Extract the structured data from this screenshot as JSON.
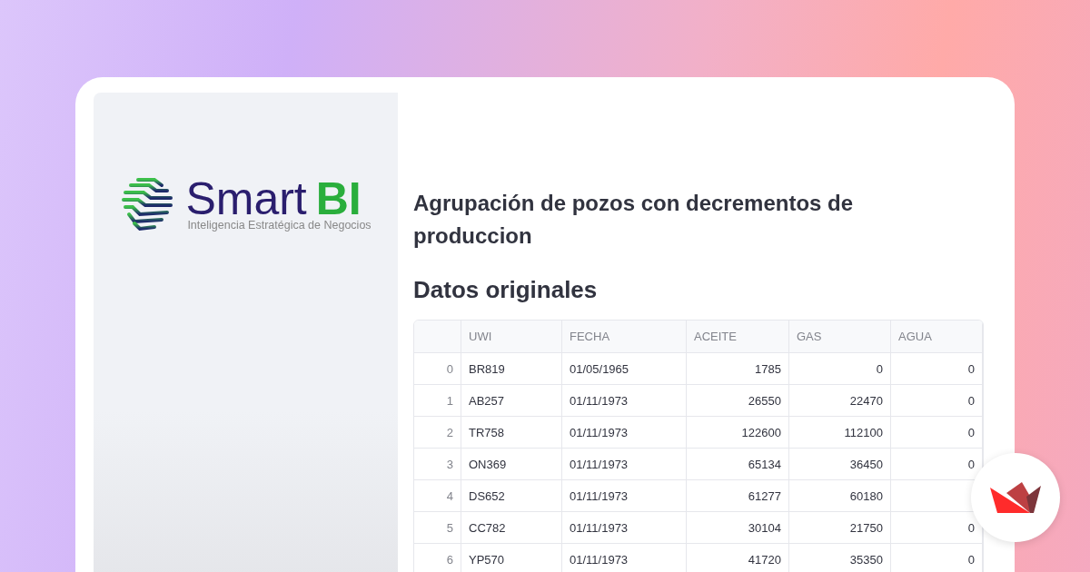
{
  "logo": {
    "name": "Smart",
    "accent": "BI",
    "tagline": "Inteligencia Estratégica de Negocios"
  },
  "title": "Agrupación de pozos con decrementos de produccion",
  "subheading": "Datos originales",
  "table": {
    "columns": [
      "UWI",
      "FECHA",
      "ACEITE",
      "GAS",
      "AGUA"
    ],
    "rows": [
      {
        "index": "0",
        "cells": [
          "BR819",
          "01/05/1965",
          "1785",
          "0",
          "0"
        ]
      },
      {
        "index": "1",
        "cells": [
          "AB257",
          "01/11/1973",
          "26550",
          "22470",
          "0"
        ]
      },
      {
        "index": "2",
        "cells": [
          "TR758",
          "01/11/1973",
          "122600",
          "112100",
          "0"
        ]
      },
      {
        "index": "3",
        "cells": [
          "ON369",
          "01/11/1973",
          "65134",
          "36450",
          "0"
        ]
      },
      {
        "index": "4",
        "cells": [
          "DS652",
          "01/11/1973",
          "61277",
          "60180"
        ]
      },
      {
        "index": "5",
        "cells": [
          "CC782",
          "01/11/1973",
          "30104",
          "21750",
          "0"
        ]
      },
      {
        "index": "6",
        "cells": [
          "YP570",
          "01/11/1973",
          "41720",
          "35350",
          "0"
        ]
      }
    ]
  }
}
